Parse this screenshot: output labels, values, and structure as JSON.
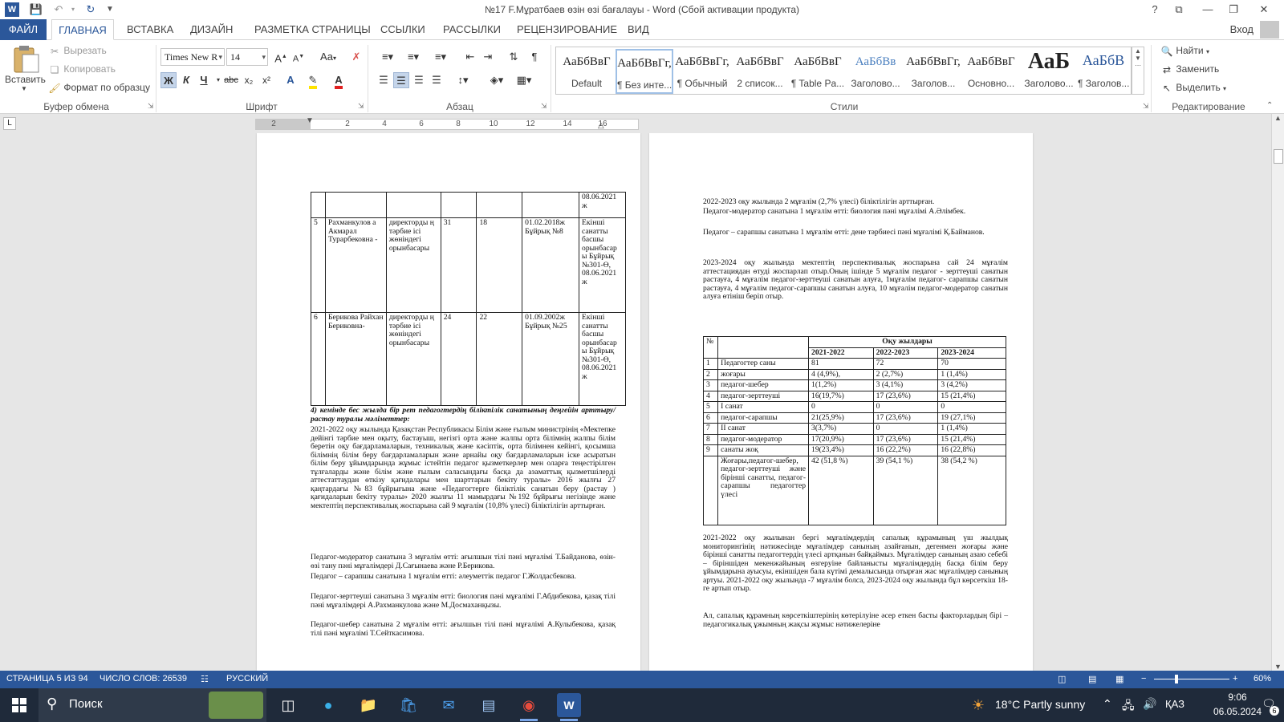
{
  "window": {
    "title": "№17 F.Мұратбаев өзін өзі бағалауы - Word (Сбой активации продукта)",
    "controls": [
      "?",
      "⧉",
      "—",
      "❐",
      "✕"
    ]
  },
  "ribbon_tabs": {
    "file": "ФАЙЛ",
    "tabs": [
      "ГЛАВНАЯ",
      "ВСТАВКА",
      "ДИЗАЙН",
      "РАЗМЕТКА СТРАНИЦЫ",
      "ССЫЛКИ",
      "РАССЫЛКИ",
      "РЕЦЕНЗИРОВАНИЕ",
      "ВИД"
    ],
    "signin": "Вход"
  },
  "clipboard": {
    "paste": "Вставить",
    "cut": "Вырезать",
    "copy": "Копировать",
    "format_painter": "Формат по образцу",
    "group": "Буфер обмена"
  },
  "font": {
    "name": "Times New R",
    "size": "14",
    "group": "Шрифт",
    "bold": "Ж",
    "italic": "К",
    "underline": "Ч",
    "strike": "abc",
    "sub": "x₂",
    "sup": "x²",
    "change_case": "Aa",
    "grow": "A",
    "shrink": "A"
  },
  "paragraph": {
    "group": "Абзац"
  },
  "styles": {
    "group": "Стили",
    "items": [
      {
        "preview": "АаБбВвГ",
        "name": "Default"
      },
      {
        "preview": "АаБбВвГг,",
        "name": "¶ Без инте..."
      },
      {
        "preview": "АаБбВвГг,",
        "name": "¶ Обычный"
      },
      {
        "preview": "АаБбВвГ",
        "name": "2 список..."
      },
      {
        "preview": "АаБбВвГ",
        "name": "¶ Table Pa..."
      },
      {
        "preview": "АаБбВв",
        "name": "Заголово..."
      },
      {
        "preview": "АаБбВвГг,",
        "name": "Заголов..."
      },
      {
        "preview": "АаБбВвГ",
        "name": "Основно..."
      },
      {
        "preview": "АаБ",
        "name": "Заголово..."
      },
      {
        "preview": "АаБбВ",
        "name": "¶ Заголов..."
      }
    ]
  },
  "editing": {
    "group": "Редактирование",
    "find": "Найти",
    "replace": "Заменить",
    "select": "Выделить"
  },
  "ruler": {
    "ticks": [
      "2",
      "2",
      "4",
      "6",
      "8",
      "10",
      "12",
      "14",
      "16"
    ]
  },
  "left_page": {
    "table_rows": [
      {
        "no": "",
        "name": "",
        "post": "",
        "c3": "",
        "c4": "",
        "c5": "",
        "c6": "08.06.2021 ж"
      },
      {
        "no": "5",
        "name": "Рахманкулов а Акмарал Турарбековна -",
        "post": "директорды ң тәрбие ісі жөніндегі орынбасары",
        "c3": "31",
        "c4": "18",
        "c5": "01.02.2018ж Бұйрық №8",
        "c6": "Екінші санатты басшы орынбасар ы Бұйрық №301-Ө, 08.06.2021 ж"
      },
      {
        "no": "6",
        "name": "Берикова Райхан Бериковна-",
        "post": "директорды ң тәрбие ісі жөніндегі орынбасары",
        "c3": "24",
        "c4": "22",
        "c5": "01.09.2002ж Бұйрық №25",
        "c6": "Екінші санатты басшы орынбасар ы Бұйрық №301-Ө, 08.06.2021 ж"
      }
    ],
    "heading": "4) кемінде бес жылда бір рет педагогтердің біліктілік санатының деңгейін арттыру/растау туралы мәліметтер:",
    "p1": "2021-2022 оқу жылында Қазақстан Республикасы Білім және ғылым министрінің «Мектепке дейінгі тәрбие мен оқыту, бастауыш, негізгі орта және жалпы орта білімнің жалпы білім беретін оқу бағдарламаларын, техникалық және кәсіптік, орта білімнен кейінгі, қосымша білімнің білім беру бағдарламаларын және арнайы оқу бағдарламаларын іске асыратын білім беру ұйымдарында жұмыс істейтін педагог қызметкерлер мен оларға теңестірілген тұлғаларды және білім және ғылым саласындағы басқа да азаматтық қызметшілерді аттестаттаудан өткізу қағидалары мен шарттарын бекіту туралы» 2016 жылғы 27 қаңтардағы №83 бұйрығына және «Педагогтерге біліктілік санатын беру (растау ) қағидаларын бекіту туралы» 2020 жылғы 11 мамырдағы №192 бұйрығы негізінде және мектептің перспективалық жоспарына сай 9 мұғалім (10,8% үлесі) біліктілігін арттырған.",
    "p2": "Педагог-модератор санатына 3 мұғалім өтті: ағылшын тілі пәні мұғалімі Т.Байданова, өзін-өзі тану пәні мұғалімдері Д.Сағынаева және Р.Берикова.",
    "p3": "Педагог – сарапшы санатына 1 мұғалім өтті: әлеуметтік педагог Г.Жолдасбекова.",
    "p4": "Педагог-зерттеуші санатына 3 мұғалім өтті: биология пәні мұғалімі Г.Абдибекова, қазақ тілі пәні мұғалімдері А.Рахманкулова және М.Досмаханқызы.",
    "p5": "Педагог-шебер санатына 2 мұғалім өтті: ағылшын тілі пәні мұғалімі А.Кулыбекова, қазақ тілі пәні мұғалімі Т.Сейткасимова."
  },
  "right_page": {
    "p1": "2022-2023 оқу жылында 2 мұғалім (2,7% үлесі) біліктілігін арттырған.",
    "p2": "Педагог-модератор санатына 1 мұғалім өтті: биология пәні мұғалімі А.Әлімбек.",
    "p3": "Педагог – сарапшы санатына 1 мұғалім өтті: дене тәрбиесі пәні мұғалімі Қ.Байманов.",
    "p4": "2023-2024 оқу жылында мектептің перспективалық жоспарына сай 24 мұғалім аттестациядан өтуді жоспарлап отыр.Оның ішінде 5 мұғалім педагог - зерттеуші санатын растауға, 4 мұғалім педагог-зерттеуші санатын алуға, 1мұғалім педагог- сарапшы санатын растауға, 4 мұғалім педагог-сарапшы санатын алуға, 10 мұғалім педагог-модератор санатын алуға өтініш беріп отыр.",
    "table": {
      "no_header": "№",
      "years_header": "Оқу жылдары",
      "years": [
        "2021-2022",
        "2022-2023",
        "2023-2024"
      ],
      "rows": [
        {
          "no": "1",
          "label": "Педагогтер саны",
          "v": [
            "81",
            "72",
            "70"
          ]
        },
        {
          "no": "2",
          "label": "жоғары",
          "v": [
            "4 (4,9%),",
            "2 (2,7%)",
            "1 (1,4%)"
          ]
        },
        {
          "no": "3",
          "label": "педагог-шебер",
          "v": [
            "1(1,2%)",
            "3 (4,1%)",
            "3 (4,2%)"
          ]
        },
        {
          "no": "4",
          "label": "педагог-зерттеуші",
          "v": [
            "16(19,7%)",
            "17 (23,6%)",
            "15 (21,4%)"
          ]
        },
        {
          "no": "5",
          "label": "І санат",
          "v": [
            "0",
            "0",
            "0"
          ]
        },
        {
          "no": "6",
          "label": "педагог-сарапшы",
          "v": [
            "21(25,9%)",
            "17 (23,6%)",
            "19 (27,1%)"
          ]
        },
        {
          "no": "7",
          "label": "ІІ санат",
          "v": [
            "3(3,7%)",
            "0",
            "1 (1,4%)"
          ]
        },
        {
          "no": "8",
          "label": "педагог-модератор",
          "v": [
            "17(20,9%)",
            "17 (23,6%)",
            "15 (21,4%)"
          ]
        },
        {
          "no": "9",
          "label": "санаты жоқ",
          "v": [
            "19(23,4%)",
            "16 (22,2%)",
            "16 (22,8%)"
          ]
        },
        {
          "no": "",
          "label": "Жоғары,педагог-шебер, педагог-зерттеуші және бірінші санатты, педагог-сарапшы педагогтер үлесі",
          "v": [
            "42 (51,8 %)",
            "39 (54,1 %)",
            "38 (54,2 %)"
          ]
        }
      ]
    },
    "p5": "2021-2022 оқу жылынан бергі мұғалімдердің сапалық құрамының үш жылдық мониторингінің нәтижесінде мұғалімдер санының азайғанын, дегенмен жоғары және бірінші санатты педагогтердің үлесі артқанын байқаймыз. Мұғалімдер санының азаю себебі – біріншіден мекенжайының өзгеруіне байланысты мұғалімдердің басқа білім беру ұйымдарына ауысуы, екіншіден бала күтімі демалысында отырған жас мұғалімдер санының артуы. 2021-2022 оқу жылында -7 мұғалім болса, 2023-2024 оқу жылында бұл көрсеткіш 18-ге артып отыр.",
    "p6": "Ал, сапалық құрамның көрсеткіштерінің көтерілуіне әсер еткен басты факторлардың бірі – педагогикалық ұжымның жақсы жұмыс нәтижелеріне"
  },
  "statusbar": {
    "page": "СТРАНИЦА 5 ИЗ 94",
    "words": "ЧИСЛО СЛОВ: 26539",
    "lang": "РУССКИЙ",
    "zoom": "60%"
  },
  "taskbar": {
    "search": "Поиск",
    "weather": "18°C  Partly sunny",
    "lang": "ҚАЗ",
    "time": "9:06",
    "date": "06.05.2024",
    "notif": "6"
  }
}
